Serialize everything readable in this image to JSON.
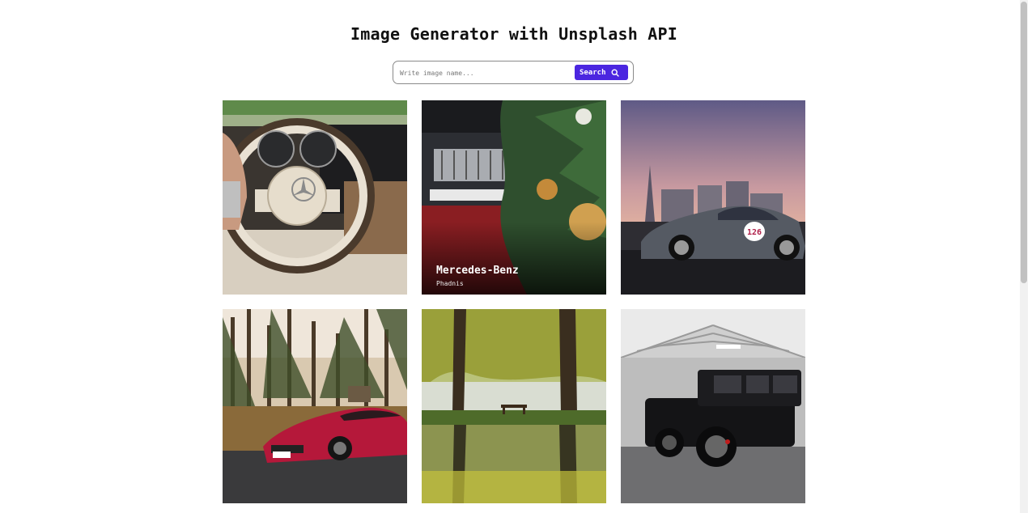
{
  "header": {
    "title": "Image Generator with Unsplash API"
  },
  "search": {
    "placeholder": "Write image name...",
    "value": "",
    "button_label": "Search",
    "icon": "search-icon"
  },
  "results": [
    {
      "alt": "steering wheel",
      "title": "",
      "author": ""
    },
    {
      "alt": "mercedes christmas",
      "title": "Mercedes-Benz",
      "author": "Phadnis"
    },
    {
      "alt": "classic gullwing",
      "title": "",
      "author": ""
    },
    {
      "alt": "red sports car",
      "title": "",
      "author": ""
    },
    {
      "alt": "forest lake",
      "title": "",
      "author": ""
    },
    {
      "alt": "black g-class",
      "title": "",
      "author": ""
    }
  ],
  "colors": {
    "accent": "#4b26e0"
  }
}
